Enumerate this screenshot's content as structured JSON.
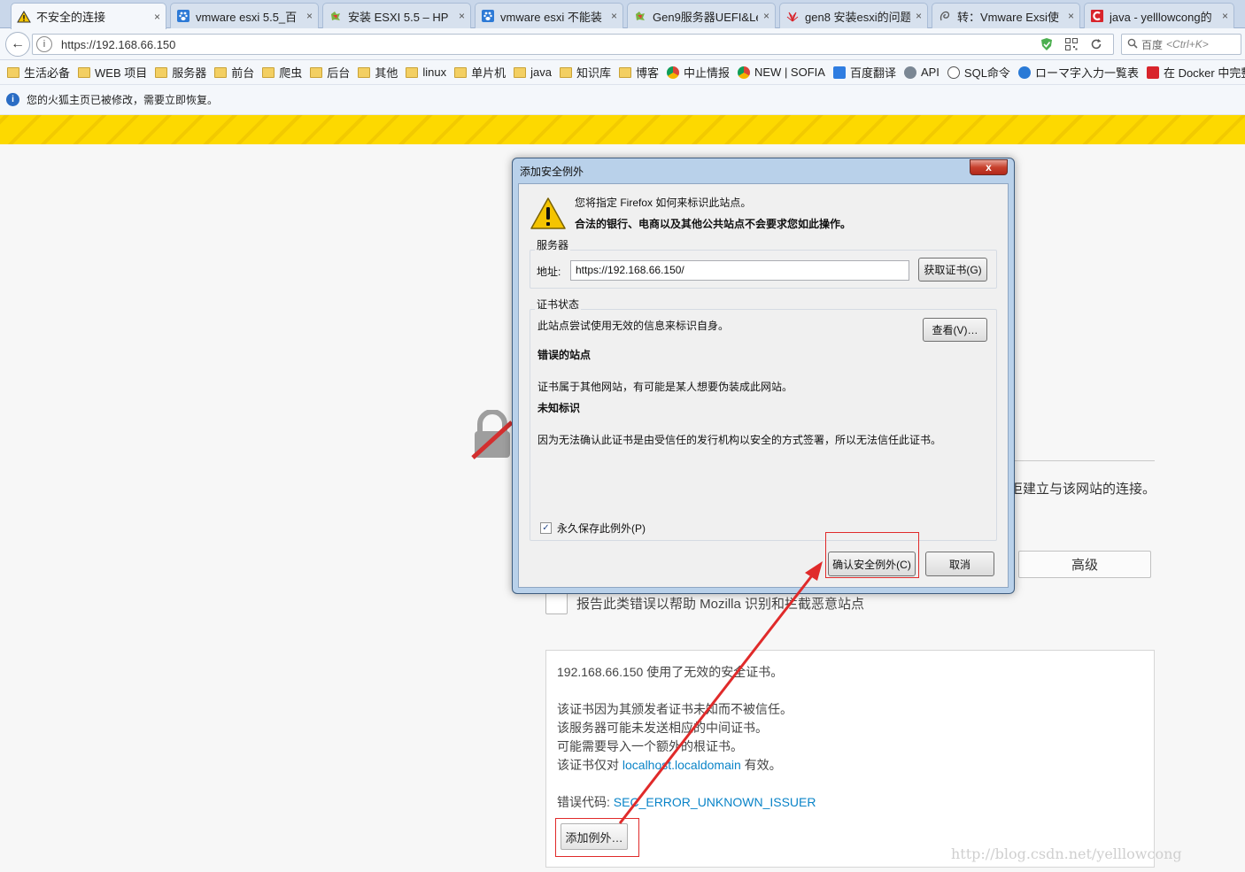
{
  "tabs": [
    {
      "label": "不安全的连接",
      "icon": "warning-icon",
      "active": true
    },
    {
      "label": "vmware esxi 5.5_百",
      "icon": "baidu-paw-icon"
    },
    {
      "label": "安装 ESXI 5.5 – HP",
      "icon": "puzzle-icon"
    },
    {
      "label": "vmware esxi 不能装",
      "icon": "baidu-paw-icon"
    },
    {
      "label": "Gen9服务器UEFI&Le",
      "icon": "puzzle-icon"
    },
    {
      "label": "gen8 安装esxi的问题",
      "icon": "huawei-icon"
    },
    {
      "label": "转：Vmware Exsi使",
      "icon": "spiral-icon"
    },
    {
      "label": "java - yelllowcong的",
      "icon": "csdn-icon"
    }
  ],
  "tab_close": "×",
  "nav": {
    "back": "←",
    "url": "https://192.168.66.150",
    "info": "i",
    "reload": "C",
    "search_prefix": "百度",
    "search_placeholder": "<Ctrl+K>"
  },
  "bookmarks": [
    {
      "label": "生活必备",
      "kind": "folder"
    },
    {
      "label": "WEB 项目",
      "kind": "folder"
    },
    {
      "label": "服务器",
      "kind": "folder"
    },
    {
      "label": "前台",
      "kind": "folder"
    },
    {
      "label": "爬虫",
      "kind": "folder"
    },
    {
      "label": "后台",
      "kind": "folder"
    },
    {
      "label": "其他",
      "kind": "folder"
    },
    {
      "label": "linux",
      "kind": "folder"
    },
    {
      "label": "单片机",
      "kind": "folder"
    },
    {
      "label": "java",
      "kind": "folder"
    },
    {
      "label": "知识库",
      "kind": "folder"
    },
    {
      "label": "博客",
      "kind": "folder"
    },
    {
      "label": "中止情报",
      "kind": "chrome"
    },
    {
      "label": "NEW | SOFIA",
      "kind": "chrome"
    },
    {
      "label": "百度翻译",
      "kind": "translate"
    },
    {
      "label": "API",
      "kind": "globe"
    },
    {
      "label": "SQL命令",
      "kind": "spiral"
    },
    {
      "label": "ローマ字入力一覧表",
      "kind": "ie"
    },
    {
      "label": "在 Docker 中完整部…",
      "kind": "csdn"
    }
  ],
  "notification": {
    "icon": "i",
    "text": "您的火狐主页已被修改，需要立即恢复。"
  },
  "page": {
    "bg_text": "拒建立与该网站的连接。",
    "advanced": "高级",
    "report": "报告此类错误以帮助 Mozilla 识别和拦截恶意站点",
    "detail": {
      "line1": "192.168.66.150 使用了无效的安全证书。",
      "line2": "该证书因为其颁发者证书未知而不被信任。",
      "line3": "该服务器可能未发送相应的中间证书。",
      "line4": "可能需要导入一个额外的根证书。",
      "line5_prefix": "该证书仅对 ",
      "line5_link": "localhost.localdomain",
      "line5_suffix": " 有效。",
      "error_prefix": "错误代码: ",
      "error_code": "SEC_ERROR_UNKNOWN_ISSUER",
      "add_exception": "添加例外…"
    },
    "watermark": "http://blog.csdn.net/yelllowcong"
  },
  "dialog": {
    "title": "添加安全例外",
    "close": "x",
    "line1": "您将指定 Firefox 如何来标识此站点。",
    "line2": "合法的银行、电商以及其他公共站点不会要求您如此操作。",
    "server_legend": "服务器",
    "address_label": "地址:",
    "address_value": "https://192.168.66.150/",
    "get_cert": "获取证书(G)",
    "status_legend": "证书状态",
    "status1": "此站点尝试使用无效的信息来标识自身。",
    "view": "查看(V)…",
    "wrong_site_title": "错误的站点",
    "wrong_site_text": "证书属于其他网站，有可能是某人想要伪装成此网站。",
    "unknown_title": "未知标识",
    "unknown_text": "因为无法确认此证书是由受信任的发行机构以安全的方式签署，所以无法信任此证书。",
    "permanent": "永久保存此例外(P)",
    "permanent_checked": true,
    "confirm": "确认安全例外(C)",
    "cancel": "取消"
  },
  "colors": {
    "annotation_red": "#e02a2a",
    "link": "#0a84c8",
    "stripe_yellow": "#fdd900"
  }
}
